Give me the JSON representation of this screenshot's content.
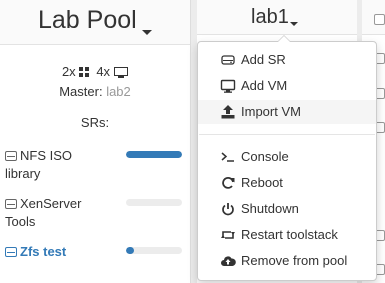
{
  "pool": {
    "title": "Lab Pool",
    "cpu_count": "2x",
    "vm_count": "4x",
    "master_label": "Master:",
    "master_value": "lab2",
    "srs_heading": "SRs:",
    "srs": [
      {
        "name": "NFS ISO library",
        "usage_fraction": 1.0,
        "active": false
      },
      {
        "name": "XenServer Tools",
        "usage_fraction": 0.0,
        "active": false
      },
      {
        "name": "Zfs test",
        "usage_fraction": 0.15,
        "active": true
      }
    ]
  },
  "host": {
    "title": "lab1"
  },
  "menu": {
    "items": [
      {
        "label": "Add SR",
        "icon": "hdd-icon"
      },
      {
        "label": "Add VM",
        "icon": "monitor-icon"
      },
      {
        "label": "Import VM",
        "icon": "upload-icon",
        "highlighted": true
      },
      {
        "label": "Console",
        "icon": "terminal-icon"
      },
      {
        "label": "Reboot",
        "icon": "refresh-icon"
      },
      {
        "label": "Shutdown",
        "icon": "power-icon"
      },
      {
        "label": "Restart toolstack",
        "icon": "retweet-icon"
      },
      {
        "label": "Remove from pool",
        "icon": "cloud-upload-icon"
      }
    ]
  },
  "colors": {
    "accent": "#337ab7",
    "muted_text": "#999999"
  }
}
